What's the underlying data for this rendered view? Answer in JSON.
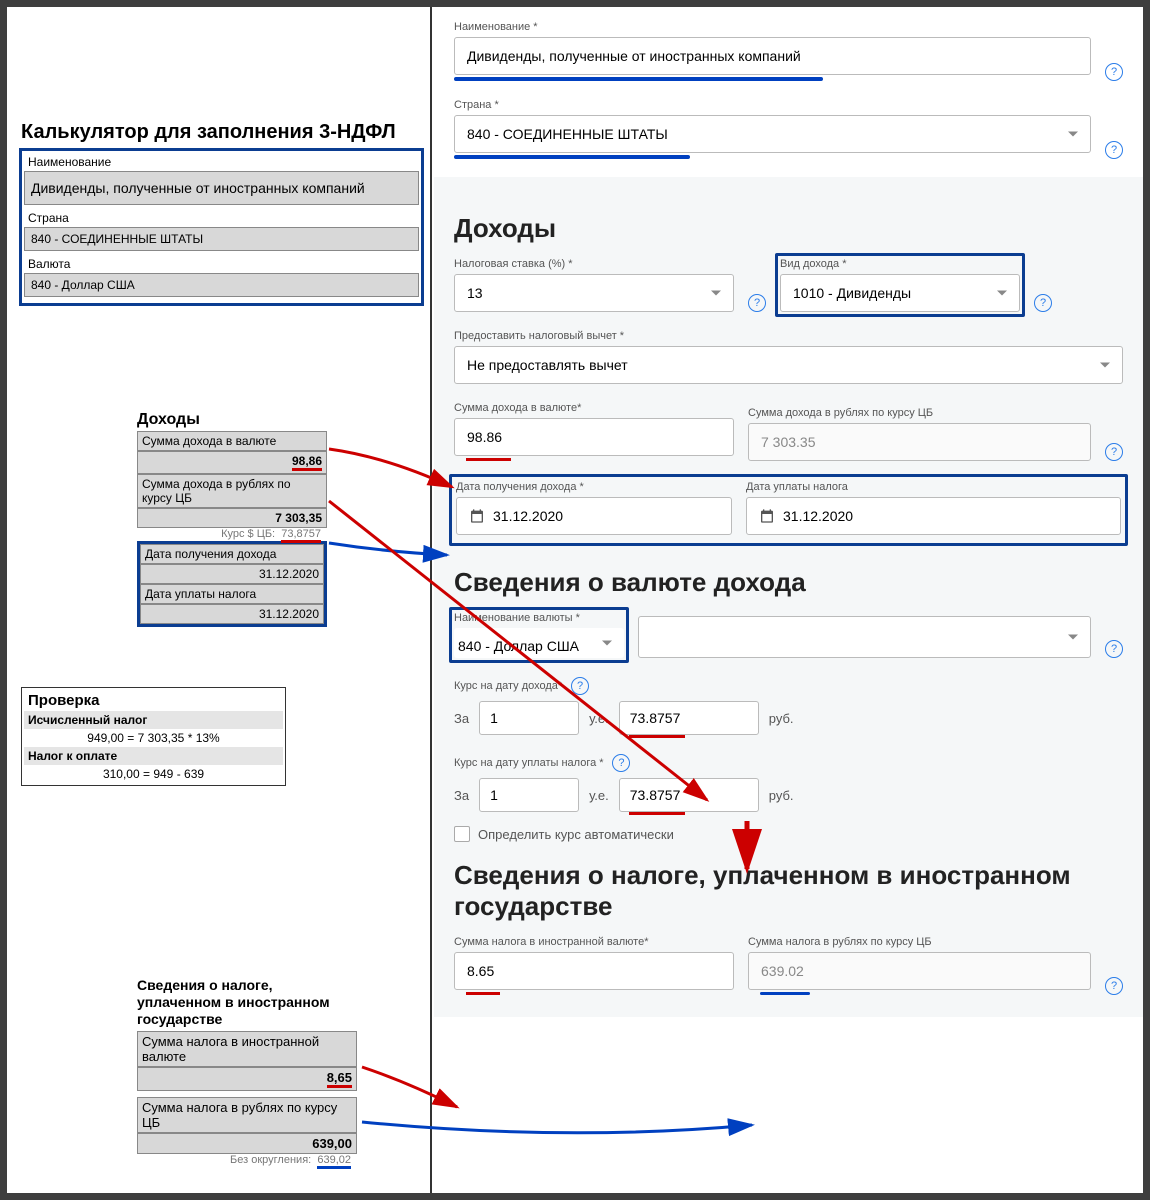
{
  "left": {
    "title": "Калькулятор для заполнения 3-НДФЛ",
    "name_label": "Наименование",
    "name_value": "Дивиденды, полученные от иностранных компаний",
    "country_label": "Страна",
    "country_value": "840 - СОЕДИНЕННЫЕ ШТАТЫ",
    "currency_label": "Валюта",
    "currency_value": "840 - Доллар США",
    "incomes_title": "Доходы",
    "income_fx_label": "Сумма дохода в валюте",
    "income_fx_value": "98,86",
    "income_rub_label": "Сумма дохода в рублях по курсу ЦБ",
    "income_rub_value": "7 303,35",
    "rate_label": "Курс $ ЦБ:",
    "rate_value": "73,8757",
    "date_income_label": "Дата получения дохода",
    "date_income_value": "31.12.2020",
    "date_tax_label": "Дата уплаты налога",
    "date_tax_value": "31.12.2020",
    "check_title": "Проверка",
    "calc_tax_label": "Исчисленный налог",
    "calc_tax_line": "949,00  =  7 303,35 * 13%",
    "tax_due_label": "Налог к оплате",
    "tax_due_line": "310,00  =  949 - 639",
    "foreign_title": "Сведения о налоге, уплаченном в иностранном государстве",
    "foreign_fx_label": "Сумма налога в иностранной валюте",
    "foreign_fx_value": "8,65",
    "foreign_rub_label": "Сумма налога в рублях по курсу ЦБ",
    "foreign_rub_value": "639,00",
    "no_round_label": "Без округления:",
    "no_round_value": "639,02"
  },
  "right": {
    "name_label": "Наименование *",
    "name_value": "Дивиденды, полученные от иностранных компаний",
    "country_label": "Страна *",
    "country_value": "840 - СОЕДИНЕННЫЕ ШТАТЫ",
    "incomes_title": "Доходы",
    "tax_rate_label": "Налоговая ставка (%) *",
    "tax_rate_value": "13",
    "income_type_label": "Вид дохода *",
    "income_type_value": "1010 - Дивиденды",
    "deduction_label": "Предоставить налоговый вычет *",
    "deduction_value": "Не предоставлять вычет",
    "income_fx_label": "Сумма дохода в валюте*",
    "income_fx_value": "98.86",
    "income_rub_label": "Сумма дохода в рублях по курсу ЦБ",
    "income_rub_value": "7 303.35",
    "date_income_label": "Дата получения дохода *",
    "date_income_value": "31.12.2020",
    "date_tax_label": "Дата уплаты налога",
    "date_tax_value": "31.12.2020",
    "currency_section_title": "Сведения о валюте дохода",
    "currency_name_label": "Наименование валюты *",
    "currency_name_value": "840 - Доллар США",
    "rate_income_label": "Курс на дату дохода*",
    "rate_tax_label": "Курс на дату уплаты налога *",
    "za": "За",
    "one": "1",
    "ue": "у.е.",
    "rate_value": "73.8757",
    "rub": "руб.",
    "auto_rate": "Определить курс автоматически",
    "foreign_section_title": "Сведения о налоге, уплаченном в иностранном государстве",
    "foreign_fx_label": "Сумма налога в иностранной валюте*",
    "foreign_fx_value": "8.65",
    "foreign_rub_label": "Сумма налога в рублях по курсу ЦБ",
    "foreign_rub_value": "639.02"
  }
}
